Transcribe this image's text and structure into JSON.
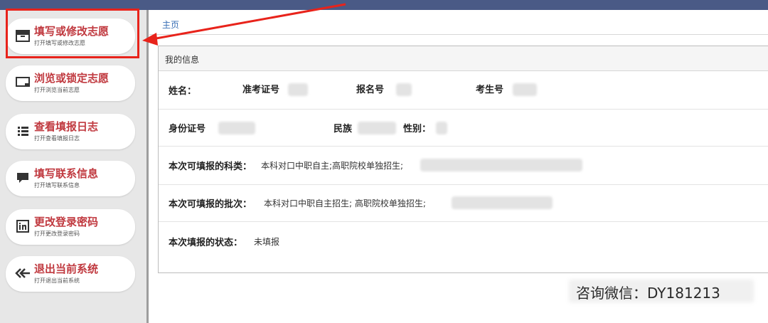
{
  "sidebar": {
    "items": [
      {
        "title": "填写或修改志愿",
        "subtitle": "打开填写或修改志愿",
        "icon": "archive-box-icon"
      },
      {
        "title": "浏览或锁定志愿",
        "subtitle": "打开浏览当前志愿",
        "icon": "monitor-icon"
      },
      {
        "title": "查看填报日志",
        "subtitle": "打开查看填报日志",
        "icon": "list-icon"
      },
      {
        "title": "填写联系信息",
        "subtitle": "打开填写联系信息",
        "icon": "chat-bubble-icon"
      },
      {
        "title": "更改登录密码",
        "subtitle": "打开更改登录密码",
        "icon": "linkedin-icon"
      },
      {
        "title": "退出当前系统",
        "subtitle": "打开退出当前系统",
        "icon": "double-back-arrow-icon"
      }
    ],
    "highlight_color": "#e8231b"
  },
  "breadcrumb": {
    "home": "主页"
  },
  "panel": {
    "title": "我的信息",
    "fields": {
      "name_label": "姓名：",
      "exam_cert_label": "准考证号",
      "registration_label": "报名号",
      "candidate_label": "考生号",
      "id_label": "身份证号",
      "ethnicity_label": "民族",
      "gender_label": "性别：",
      "subjects_label": "本次可填报的科类：",
      "subjects_value": "本科对口中职自主;高职院校单独招生;",
      "batches_label": "本次可填报的批次：",
      "batches_value": "本科对口中职自主招生; 高职院校单独招生;",
      "status_label": "本次填报的状态：",
      "status_value": "未填报"
    }
  },
  "watermark": {
    "text": "咨询微信：DY181213"
  },
  "colors": {
    "accent_red": "#c0393f",
    "top_bar": "#4a5a86",
    "link_blue": "#3a6fb5"
  }
}
